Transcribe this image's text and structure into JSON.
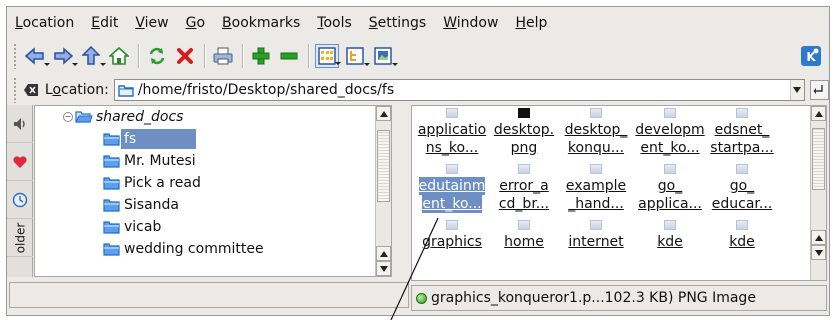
{
  "menu": [
    {
      "u": "L",
      "rest": "ocation"
    },
    {
      "u": "E",
      "rest": "dit"
    },
    {
      "u": "V",
      "rest": "iew"
    },
    {
      "u": "G",
      "rest": "o"
    },
    {
      "u": "B",
      "rest": "ookmarks"
    },
    {
      "u": "T",
      "rest": "ools"
    },
    {
      "u": "S",
      "rest": "ettings"
    },
    {
      "u": "W",
      "rest": "indow"
    },
    {
      "u": "H",
      "rest": "elp"
    }
  ],
  "location": {
    "label_u": "o",
    "label_pre": "L",
    "label_post": "cation:",
    "path": "/home/fristo/Desktop/shared_docs/fs"
  },
  "sidetabs": {
    "folder_tab": "older"
  },
  "tree": {
    "root": "shared_docs",
    "items": [
      "fs",
      "Mr. Mutesi",
      "Pick a read",
      "Sisanda",
      "vicab",
      "wedding committee"
    ]
  },
  "icons": [
    {
      "l1": "applicatio",
      "l2": "ns_ko..."
    },
    {
      "l1": "desktop.",
      "l2": "png"
    },
    {
      "l1": "desktop_",
      "l2": "konqu..."
    },
    {
      "l1": "developm",
      "l2": "ent_ko..."
    },
    {
      "l1": "edsnet_",
      "l2": "startpa..."
    },
    {
      "l1": "edutainm",
      "l2": "ent_ko..."
    },
    {
      "l1": "error_a",
      "l2": "cd_br..."
    },
    {
      "l1": "example",
      "l2": "_hand..."
    },
    {
      "l1": "go_",
      "l2": "applica..."
    },
    {
      "l1": "go_",
      "l2": "educar..."
    },
    {
      "l1": "graphics",
      "l2": ""
    },
    {
      "l1": "home",
      "l2": ""
    },
    {
      "l1": "internet",
      "l2": ""
    },
    {
      "l1": "kde",
      "l2": ""
    },
    {
      "l1": "kde",
      "l2": ""
    }
  ],
  "status": {
    "file": "graphics_konqueror1.p...102.3 KB)  PNG Image"
  },
  "colors": {
    "selection": "#6e8fc4",
    "kde_blue": "#2f78d0"
  }
}
